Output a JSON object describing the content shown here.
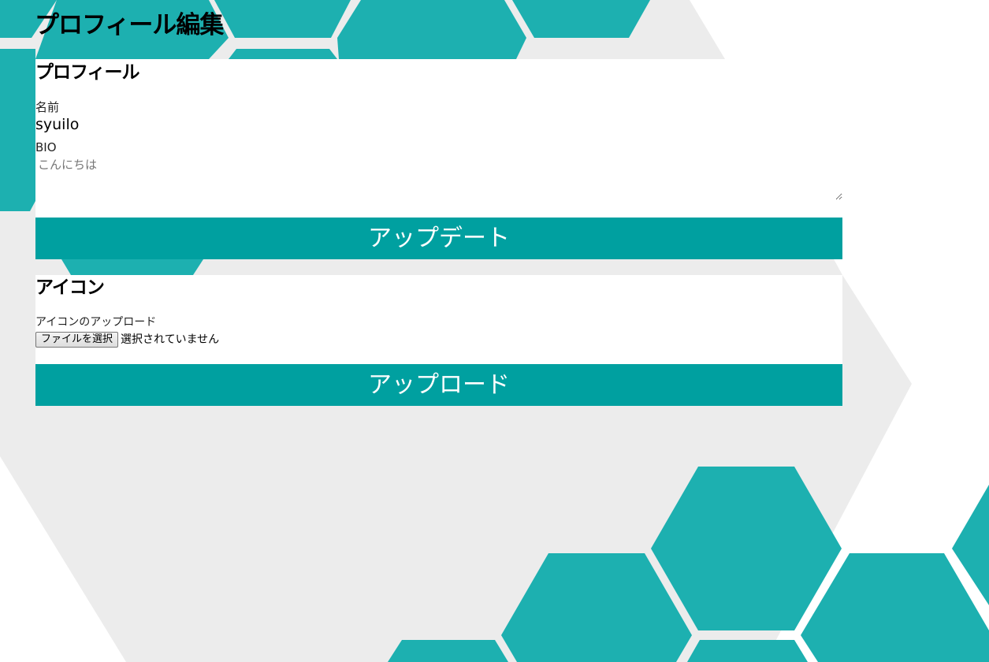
{
  "page": {
    "title": "プロフィール編集"
  },
  "profile_section": {
    "title": "プロフィール",
    "name_label": "名前",
    "name_value": "syuilo",
    "bio_label": "BIO",
    "bio_placeholder": "こんにちは",
    "bio_value": "",
    "update_button_label": "アップデート"
  },
  "icon_section": {
    "title": "アイコン",
    "upload_label": "アイコンのアップロード",
    "file_button_label": "ファイルを選択",
    "file_status": "選択されていません",
    "upload_button_label": "アップロード"
  },
  "theme": {
    "accent": "#00a0a0",
    "hex_color": "#1db0b0",
    "bg_gray": "#ececec",
    "button_text": "#ffffff"
  }
}
